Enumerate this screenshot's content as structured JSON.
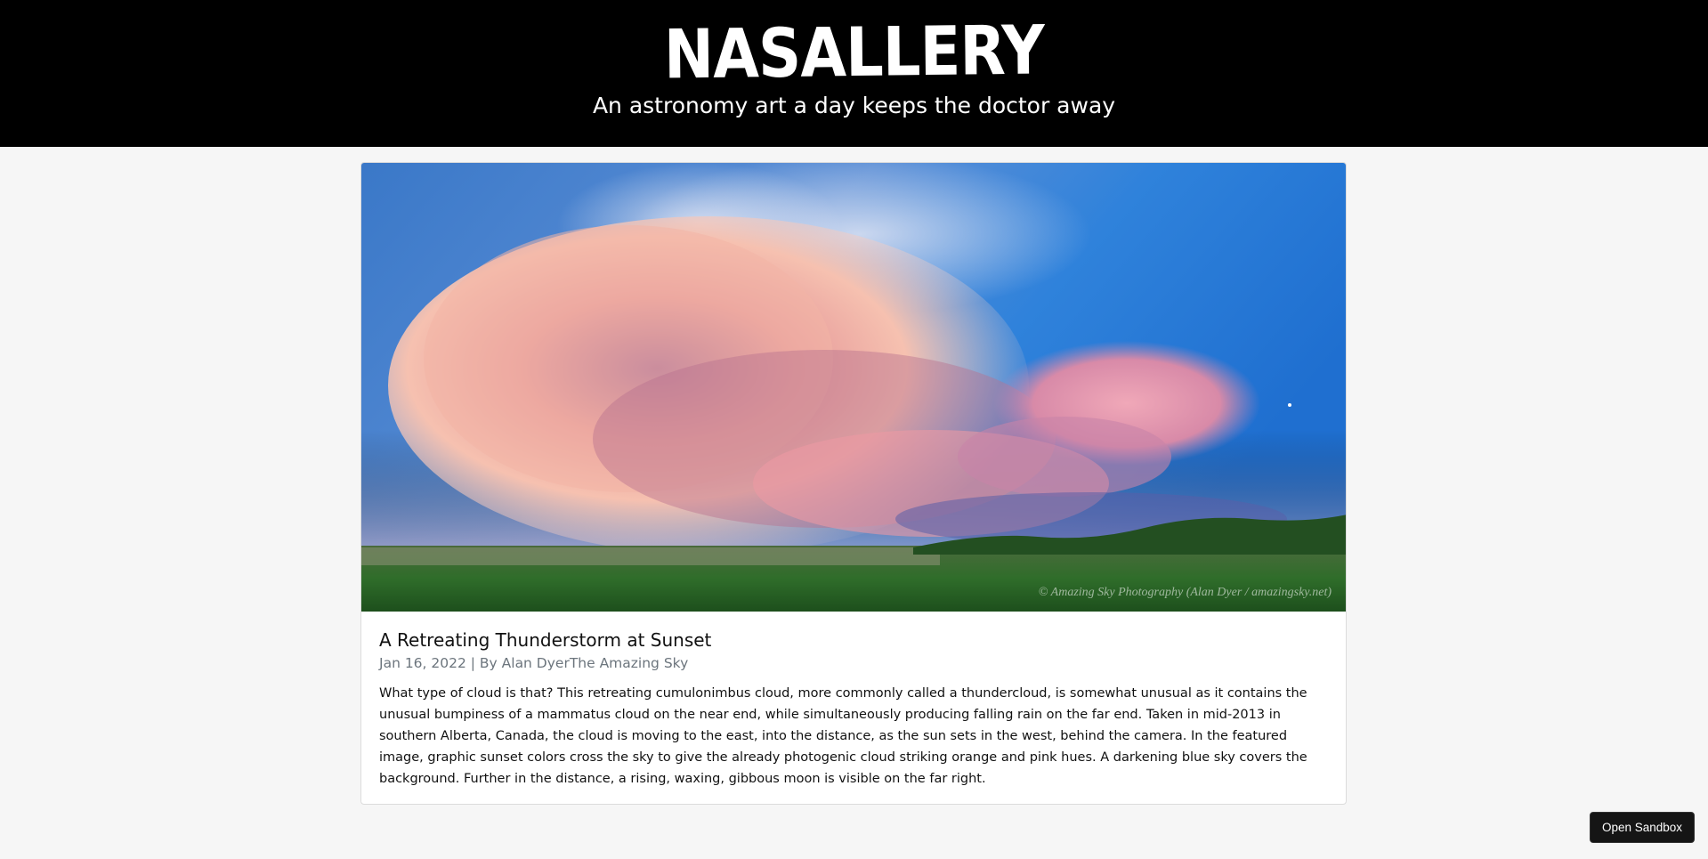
{
  "header": {
    "title": "NASALLERY",
    "tagline": "An astronomy art a day keeps the doctor away"
  },
  "post": {
    "image_alt": "A Retreating Thunderstorm at Sunset",
    "image_watermark": "© Amazing Sky Photography (Alan Dyer / amazingsky.net)",
    "title": "A Retreating Thunderstorm at Sunset",
    "meta": "Jan 16, 2022 | By Alan DyerThe Amazing Sky",
    "description": "What type of cloud is that? This retreating cumulonimbus cloud, more commonly called a thundercloud, is somewhat unusual as it contains the unusual bumpiness of a mammatus cloud on the near end, while simultaneously producing falling rain on the far end. Taken in mid-2013 in southern Alberta, Canada, the cloud is moving to the east, into the distance, as the sun sets in the west, behind the camera. In the featured image, graphic sunset colors cross the sky to give the already photogenic cloud striking orange and pink hues. A darkening blue sky covers the background. Further in the distance, a rising, waxing, gibbous moon is visible on the far right."
  },
  "sandbox": {
    "label": "Open Sandbox"
  },
  "colors": {
    "header_bg": "#000000",
    "page_bg": "#f6f6f6",
    "meta_text": "#6c757d",
    "button_bg": "#151515"
  }
}
